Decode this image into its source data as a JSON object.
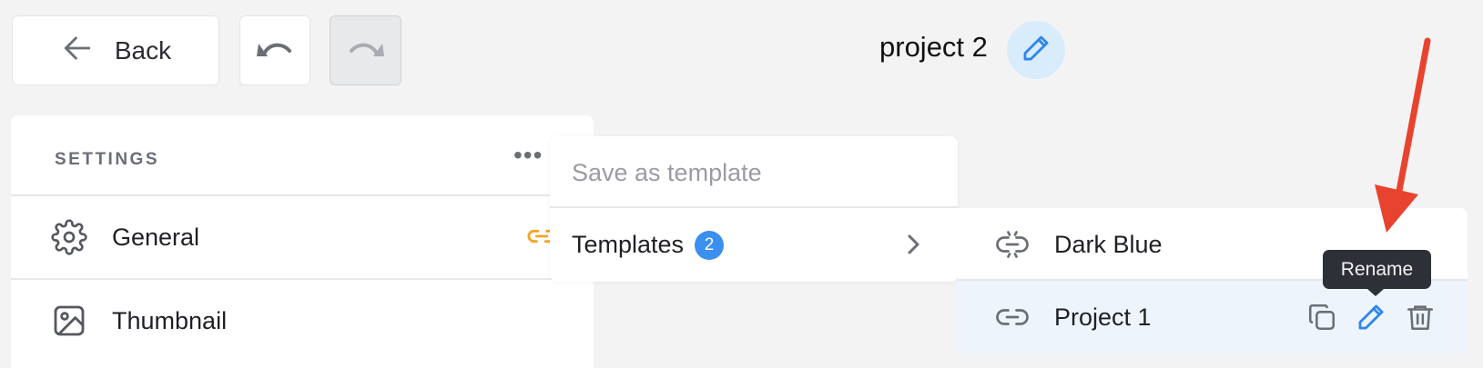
{
  "toolbar": {
    "back_label": "Back",
    "back_icon": "arrow-left-icon",
    "undo_icon": "undo-icon",
    "redo_icon": "redo-icon"
  },
  "header": {
    "project_title": "project 2",
    "edit_icon": "pencil-icon"
  },
  "settings": {
    "title": "SETTINGS",
    "more_icon": "ellipsis-icon",
    "items": [
      {
        "label": "General",
        "icon": "gear-icon"
      },
      {
        "label": "Thumbnail",
        "icon": "image-icon"
      }
    ]
  },
  "template_menu": {
    "save_label": "Save as template",
    "templates_label": "Templates",
    "templates_count": "2"
  },
  "templates_submenu": {
    "items": [
      {
        "label": "Dark Blue",
        "icon": "link-broken-icon"
      },
      {
        "label": "Project 1",
        "icon": "link-icon"
      }
    ],
    "actions": [
      "copy-icon",
      "pencil-icon",
      "trash-icon"
    ],
    "tooltip": "Rename"
  },
  "colors": {
    "accent_blue": "#3a8fef",
    "link_orange": "#f5a524",
    "annotation_red": "#e8432e"
  }
}
